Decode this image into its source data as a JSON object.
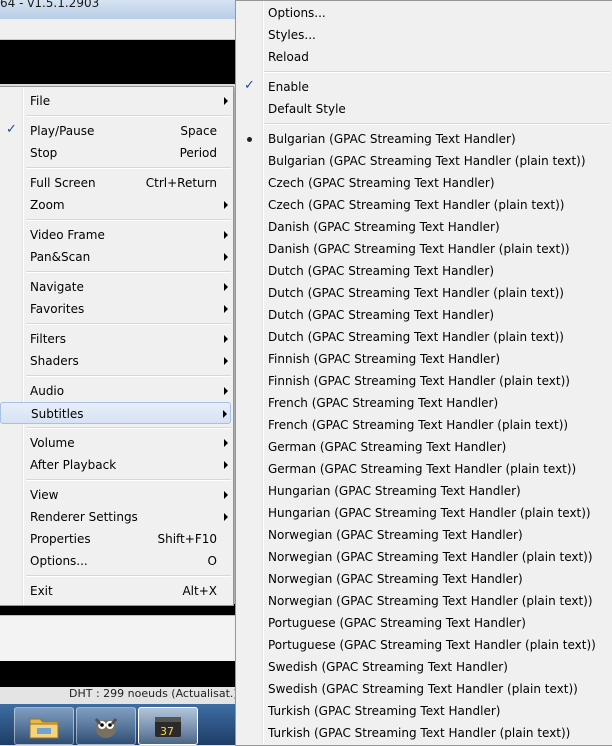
{
  "window": {
    "title_fragment": "64 - v1.5.1.2903"
  },
  "status_text": "DHT : 299 noeuds (Actualisat.)",
  "taskbar": {
    "buttons": [
      {
        "icon": "file-explorer-icon"
      },
      {
        "icon": "gimp-icon"
      },
      {
        "icon": "media-player-classic-icon",
        "badge": "37"
      }
    ]
  },
  "main_menu": {
    "items": [
      {
        "label": "File",
        "submenu": true
      },
      {
        "label": "Play/Pause",
        "accel": "Space",
        "checked": true
      },
      {
        "label": "Stop",
        "accel": "Period"
      },
      {
        "label": "Full Screen",
        "accel": "Ctrl+Return"
      },
      {
        "label": "Zoom",
        "submenu": true
      },
      {
        "label": "Video Frame",
        "submenu": true
      },
      {
        "label": "Pan&Scan",
        "submenu": true
      },
      {
        "label": "Navigate",
        "submenu": true
      },
      {
        "label": "Favorites",
        "submenu": true
      },
      {
        "label": "Filters",
        "submenu": true
      },
      {
        "label": "Shaders",
        "submenu": true
      },
      {
        "label": "Audio",
        "submenu": true
      },
      {
        "label": "Subtitles",
        "submenu": true,
        "highlighted": true
      },
      {
        "label": "Volume",
        "submenu": true
      },
      {
        "label": "After Playback",
        "submenu": true
      },
      {
        "label": "View",
        "submenu": true
      },
      {
        "label": "Renderer Settings",
        "submenu": true
      },
      {
        "label": "Properties",
        "accel": "Shift+F10"
      },
      {
        "label": "Options...",
        "accel": "O"
      },
      {
        "label": "Exit",
        "accel": "Alt+X"
      }
    ]
  },
  "subtitles_menu": {
    "top_items": [
      "Options...",
      "Styles...",
      "Reload"
    ],
    "enable_label": "Enable",
    "default_style_label": "Default Style",
    "tracks": [
      "Bulgarian (GPAC Streaming Text Handler)",
      "Bulgarian (GPAC Streaming Text Handler (plain text))",
      "Czech (GPAC Streaming Text Handler)",
      "Czech (GPAC Streaming Text Handler (plain text))",
      "Danish (GPAC Streaming Text Handler)",
      "Danish (GPAC Streaming Text Handler (plain text))",
      "Dutch (GPAC Streaming Text Handler)",
      "Dutch (GPAC Streaming Text Handler (plain text))",
      "Dutch (GPAC Streaming Text Handler)",
      "Dutch (GPAC Streaming Text Handler (plain text))",
      "Finnish (GPAC Streaming Text Handler)",
      "Finnish (GPAC Streaming Text Handler (plain text))",
      "French (GPAC Streaming Text Handler)",
      "French (GPAC Streaming Text Handler (plain text))",
      "German (GPAC Streaming Text Handler)",
      "German (GPAC Streaming Text Handler (plain text))",
      "Hungarian (GPAC Streaming Text Handler)",
      "Hungarian (GPAC Streaming Text Handler (plain text))",
      "Norwegian (GPAC Streaming Text Handler)",
      "Norwegian (GPAC Streaming Text Handler (plain text))",
      "Norwegian (GPAC Streaming Text Handler)",
      "Norwegian (GPAC Streaming Text Handler (plain text))",
      "Portuguese (GPAC Streaming Text Handler)",
      "Portuguese (GPAC Streaming Text Handler (plain text))",
      "Swedish (GPAC Streaming Text Handler)",
      "Swedish (GPAC Streaming Text Handler (plain text))",
      "Turkish (GPAC Streaming Text Handler)",
      "Turkish (GPAC Streaming Text Handler (plain text))"
    ],
    "selected_track": "Bulgarian (GPAC Streaming Text Handler)"
  }
}
